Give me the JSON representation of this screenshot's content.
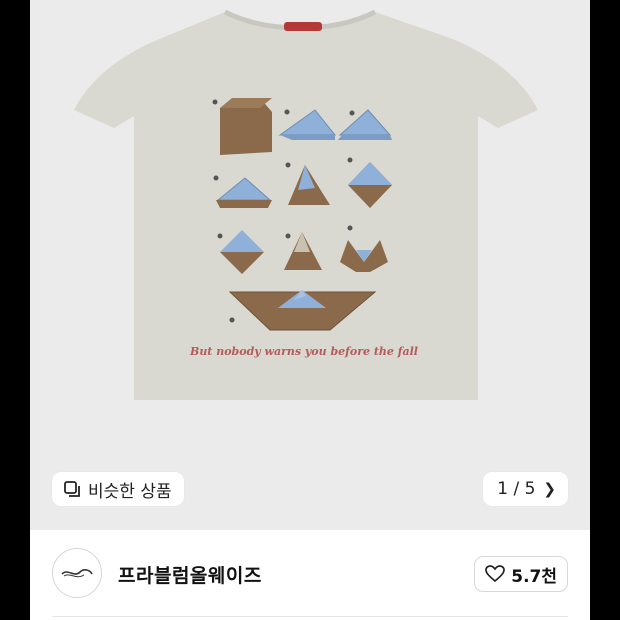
{
  "product": {
    "image_alt": "grey t-shirt with origami paper boat folding steps print",
    "print_text": "But nobody warns you before the fall"
  },
  "similar_button": {
    "icon": "similar-items-icon",
    "label": "비슷한 상품"
  },
  "pager": {
    "label": "1 / 5",
    "icon": "chevron-right-icon",
    "current": 1,
    "total": 5
  },
  "shop": {
    "name": "프라블럼올웨이즈",
    "logo_icon": "brand-logo-icon"
  },
  "like": {
    "icon": "heart-icon",
    "count_label": "5.7천"
  },
  "colors": {
    "photo_bg": "#ebebeb",
    "shirt": "#d9d8d1",
    "paper_brown": "#8a6a4a",
    "paper_blue": "#8fb0d9",
    "print_text": "#b55a5a"
  }
}
